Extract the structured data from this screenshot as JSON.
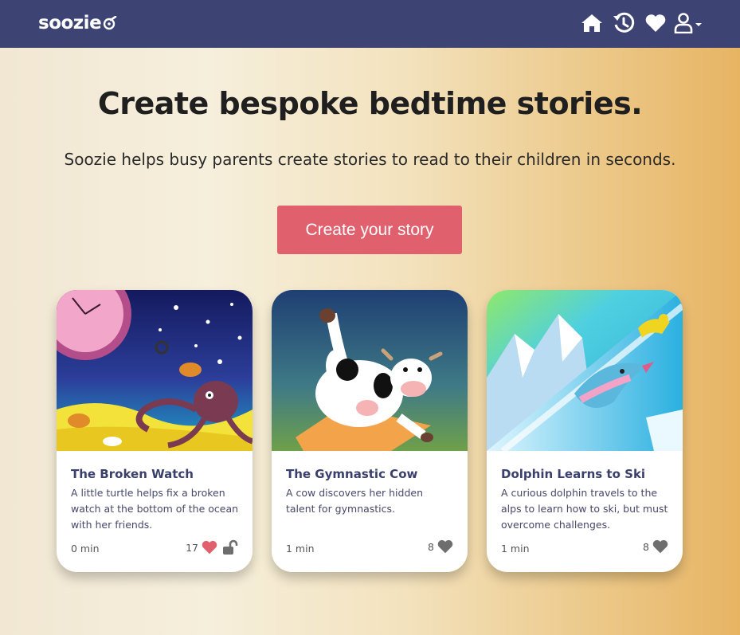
{
  "brand": {
    "name": "soozie",
    "logo_icon": "moon-swirl-icon"
  },
  "nav": {
    "icons": [
      "home-icon",
      "history-icon",
      "heart-icon",
      "user-icon"
    ],
    "text_color": "#ffffff",
    "background": "#3d4474"
  },
  "hero": {
    "title": "Create bespoke bedtime stories.",
    "subtitle": "Soozie helps busy parents create stories to read to their children in seconds.",
    "cta_label": "Create your story",
    "cta_color": "#e0616d"
  },
  "stories": [
    {
      "title": "The Broken Watch",
      "description": "A little turtle helps fix a broken watch at the bottom of the ocean with her friends.",
      "duration": "0 min",
      "likes": "17",
      "liked": true,
      "locked_icon": "unlock-icon",
      "like_color": "#e0616d"
    },
    {
      "title": "The Gymnastic Cow",
      "description": "A cow discovers her hidden talent for gymnastics.",
      "duration": "1 min",
      "likes": "8",
      "liked": false,
      "like_color": "#6e6e6e"
    },
    {
      "title": "Dolphin Learns to Ski",
      "description": "A curious dolphin travels to the alps to learn how to ski, but must overcome challenges.",
      "duration": "1 min",
      "likes": "8",
      "liked": false,
      "like_color": "#6e6e6e"
    }
  ]
}
